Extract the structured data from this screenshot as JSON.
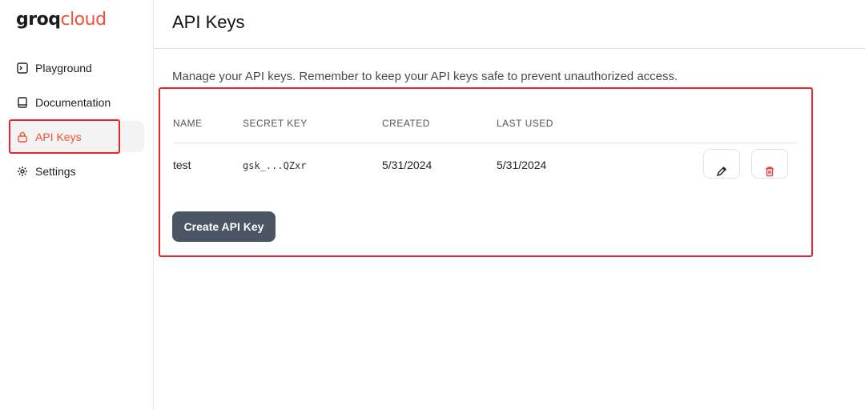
{
  "brand": {
    "name_part1": "groq",
    "name_part2": "cloud",
    "accent": "#f55036"
  },
  "sidebar": {
    "items": [
      {
        "label": "Playground",
        "icon": "terminal-icon"
      },
      {
        "label": "Documentation",
        "icon": "book-icon"
      },
      {
        "label": "API Keys",
        "icon": "lock-icon",
        "active": true
      },
      {
        "label": "Settings",
        "icon": "gear-icon"
      }
    ]
  },
  "header": {
    "title": "API Keys"
  },
  "main": {
    "description": "Manage your API keys. Remember to keep your API keys safe to prevent unauthorized access.",
    "table": {
      "columns": [
        "NAME",
        "SECRET KEY",
        "CREATED",
        "LAST USED"
      ],
      "rows": [
        {
          "name": "test",
          "secret_key": "gsk_...QZxr",
          "created": "5/31/2024",
          "last_used": "5/31/2024"
        }
      ]
    },
    "create_button_label": "Create API Key"
  },
  "colors": {
    "highlight": "#e8262b",
    "button_bg": "#4b5563",
    "delete_icon": "#e5484d"
  }
}
